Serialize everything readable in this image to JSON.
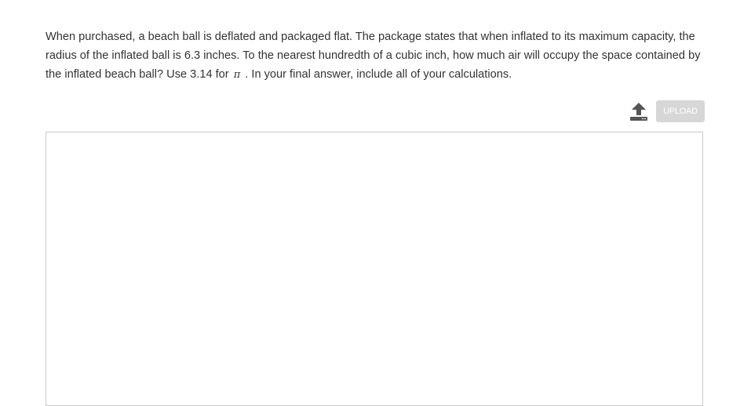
{
  "question": {
    "text_before_pi": "When purchased, a beach ball is deflated and packaged flat. The package states that when inflated to its maximum capacity, the radius of the inflated ball is 6.3 inches. To the nearest hundredth of a cubic inch, how much air will occupy the space contained by the inflated beach ball? Use 3.14 for",
    "pi_symbol": "π",
    "text_after_pi": ". In your final answer, include all of your calculations."
  },
  "upload": {
    "icon": "upload-icon",
    "button_label": "UPLOAD",
    "button_color": "#d7d7d7",
    "icon_color": "#555555"
  },
  "answer_box": {
    "value": ""
  }
}
